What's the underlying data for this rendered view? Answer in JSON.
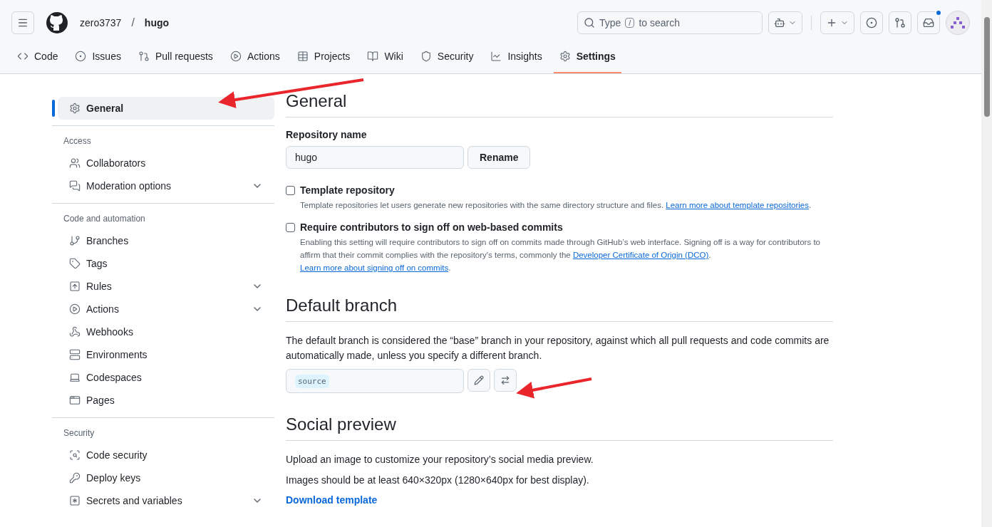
{
  "header": {
    "owner": "zero3737",
    "separator": "/",
    "repo": "hugo",
    "search": {
      "prefix": "Type",
      "key": "/",
      "suffix": "to search"
    },
    "inbox_unread": true
  },
  "tabs": [
    {
      "label": "Code",
      "selected": false
    },
    {
      "label": "Issues",
      "selected": false
    },
    {
      "label": "Pull requests",
      "selected": false
    },
    {
      "label": "Actions",
      "selected": false
    },
    {
      "label": "Projects",
      "selected": false
    },
    {
      "label": "Wiki",
      "selected": false
    },
    {
      "label": "Security",
      "selected": false
    },
    {
      "label": "Insights",
      "selected": false
    },
    {
      "label": "Settings",
      "selected": true
    }
  ],
  "sidebar": {
    "sections": [
      {
        "items": [
          {
            "label": "General",
            "selected": true,
            "expandable": false
          }
        ]
      },
      {
        "heading": "Access",
        "items": [
          {
            "label": "Collaborators",
            "selected": false,
            "expandable": false
          },
          {
            "label": "Moderation options",
            "selected": false,
            "expandable": true
          }
        ]
      },
      {
        "heading": "Code and automation",
        "items": [
          {
            "label": "Branches",
            "selected": false,
            "expandable": false
          },
          {
            "label": "Tags",
            "selected": false,
            "expandable": false
          },
          {
            "label": "Rules",
            "selected": false,
            "expandable": true
          },
          {
            "label": "Actions",
            "selected": false,
            "expandable": true
          },
          {
            "label": "Webhooks",
            "selected": false,
            "expandable": false
          },
          {
            "label": "Environments",
            "selected": false,
            "expandable": false
          },
          {
            "label": "Codespaces",
            "selected": false,
            "expandable": false
          },
          {
            "label": "Pages",
            "selected": false,
            "expandable": false
          }
        ]
      },
      {
        "heading": "Security",
        "items": [
          {
            "label": "Code security",
            "selected": false,
            "expandable": false
          },
          {
            "label": "Deploy keys",
            "selected": false,
            "expandable": false
          },
          {
            "label": "Secrets and variables",
            "selected": false,
            "expandable": true
          }
        ]
      }
    ]
  },
  "main": {
    "title": "General",
    "repo_name": {
      "label": "Repository name",
      "value": "hugo",
      "button": "Rename"
    },
    "options": [
      {
        "label": "Template repository",
        "checked": false,
        "description": [
          {
            "kind": "text",
            "text": "Template repositories let users generate new repositories with the same directory structure and files. "
          },
          {
            "kind": "link",
            "text": "Learn more about template repositories"
          },
          {
            "kind": "text",
            "text": "."
          }
        ]
      },
      {
        "label": "Require contributors to sign off on web-based commits",
        "checked": false,
        "description": [
          {
            "kind": "text",
            "text": "Enabling this setting will require contributors to sign off on commits made through GitHub’s web interface. Signing off is a way for contributors to affirm that their commit complies with the repository's terms, commonly the "
          },
          {
            "kind": "link",
            "text": "Developer Certificate of Origin (DCO)"
          },
          {
            "kind": "text",
            "text": ". "
          },
          {
            "kind": "link",
            "text": "Learn more about signing off on commits"
          },
          {
            "kind": "text",
            "text": "."
          }
        ]
      }
    ],
    "default_branch": {
      "title": "Default branch",
      "description": "The default branch is considered the “base” branch in your repository, against which all pull requests and code commits are automatically made, unless you specify a different branch.",
      "branch": "source"
    },
    "social_preview": {
      "title": "Social preview",
      "lines": [
        "Upload an image to customize your repository’s social media preview.",
        "Images should be at least 640×320px (1280×640px for best display)."
      ],
      "link": "Download template"
    }
  }
}
